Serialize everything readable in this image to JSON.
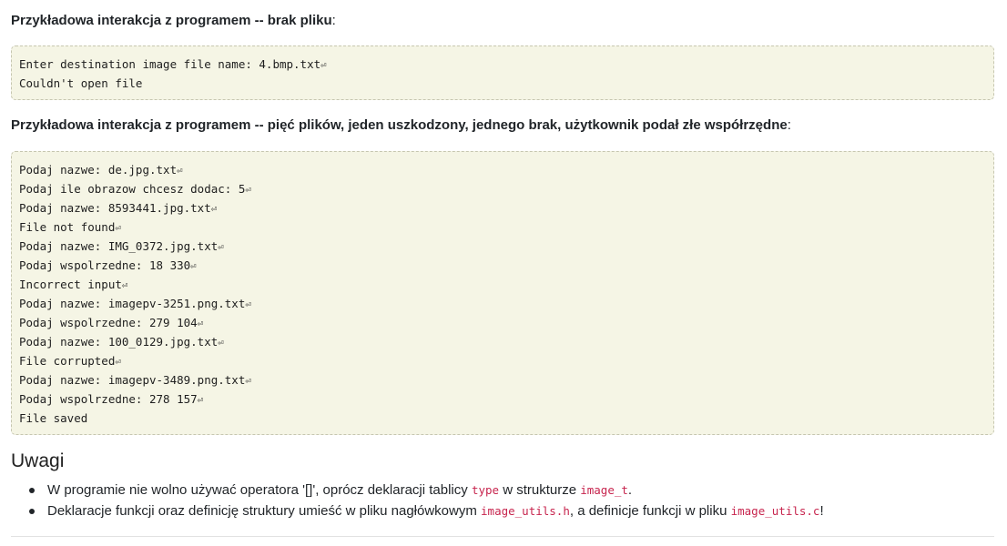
{
  "example1": {
    "caption": "Przykładowa interakcja z programem -- brak pliku",
    "caption_suffix": ":",
    "lines": [
      {
        "text": "Enter destination image file name: 4.bmp.txt",
        "ret": true
      },
      {
        "text": "Couldn't open file",
        "ret": false
      }
    ]
  },
  "example2": {
    "caption": "Przykładowa interakcja z programem -- pięć plików, jeden uszkodzony, jednego brak, użytkownik podał złe współrzędne",
    "caption_suffix": ":",
    "lines": [
      {
        "text": "Podaj nazwe: de.jpg.txt",
        "ret": true
      },
      {
        "text": "Podaj ile obrazow chcesz dodac: 5",
        "ret": true
      },
      {
        "text": "Podaj nazwe: 8593441.jpg.txt",
        "ret": true
      },
      {
        "text": "File not found",
        "ret": true
      },
      {
        "text": "Podaj nazwe: IMG_0372.jpg.txt",
        "ret": true
      },
      {
        "text": "Podaj wspolrzedne: 18 330",
        "ret": true
      },
      {
        "text": "Incorrect input",
        "ret": true
      },
      {
        "text": "Podaj nazwe: imagepv-3251.png.txt",
        "ret": true
      },
      {
        "text": "Podaj wspolrzedne: 279 104",
        "ret": true
      },
      {
        "text": "Podaj nazwe: 100_0129.jpg.txt",
        "ret": true
      },
      {
        "text": "File corrupted",
        "ret": true
      },
      {
        "text": "Podaj nazwe: imagepv-3489.png.txt",
        "ret": true
      },
      {
        "text": "Podaj wspolrzedne: 278 157",
        "ret": true
      },
      {
        "text": "File saved",
        "ret": false
      }
    ]
  },
  "return_symbol": "⏎",
  "notes": {
    "heading": "Uwagi",
    "item1": {
      "before": "W programie nie wolno używać operatora '[]', oprócz deklaracji tablicy ",
      "code1": "type",
      "middle": " w strukturze ",
      "code2": "image_t",
      "after": "."
    },
    "item2": {
      "before": "Deklaracje funkcji oraz definicję struktury umieść w pliku nagłówkowym ",
      "code1": "image_utils.h",
      "middle": ", a definicje funkcji w pliku ",
      "code2": "image_utils.c",
      "after": "!"
    }
  },
  "colors": {
    "code_background": "#f5f5e5",
    "code_border": "#c6c6b0",
    "inline_code": "#c7254e",
    "text": "#212529"
  }
}
